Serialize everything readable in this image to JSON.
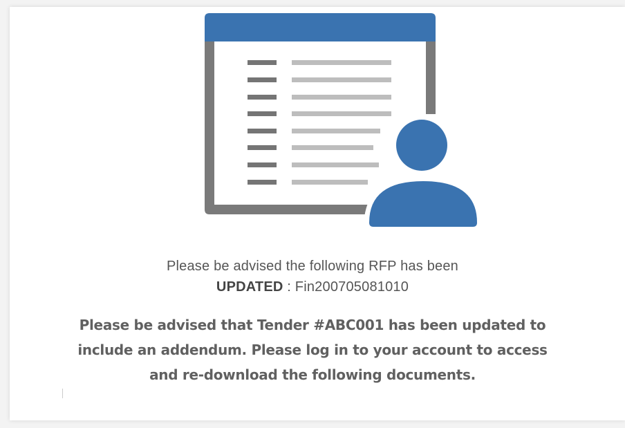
{
  "notice": {
    "headline_prefix": "Please be advised the following RFP has been",
    "status_word": "UPDATED",
    "separator": " : ",
    "rfp_id": "Fin200705081010",
    "body": "Please be advised that Tender #ABC001 has been updated to include an addendum. Please log in to your account to access and re-download the following documents."
  },
  "illustration": {
    "icon": "document-user-icon",
    "accent_color": "#3a73b0",
    "document_line_color": "#bdbdbd",
    "bullet_color": "#757575"
  }
}
